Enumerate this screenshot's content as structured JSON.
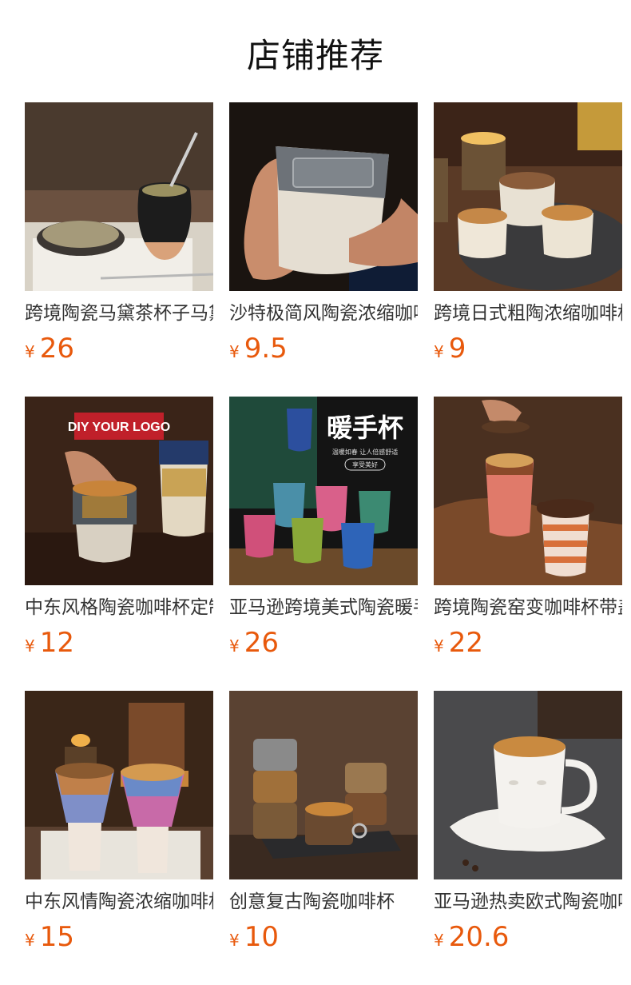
{
  "page": {
    "title": "店铺推荐"
  },
  "products": [
    {
      "name": "跨境陶瓷马黛茶杯子马黛茶壶",
      "currency": "¥",
      "price": "26",
      "image": "black-mate-cup-with-straw"
    },
    {
      "name": "沙特极简风陶瓷浓缩咖啡杯",
      "currency": "¥",
      "price": "9.5",
      "image": "hand-holding-grey-cup"
    },
    {
      "name": "跨境日式粗陶浓缩咖啡杯",
      "currency": "¥",
      "price": "9",
      "image": "three-latte-cups-on-slate"
    },
    {
      "name": "中东风格陶瓷咖啡杯定制",
      "currency": "¥",
      "price": "12",
      "image": "diy-logo-cups"
    },
    {
      "name": "亚马逊跨境美式陶瓷暖手杯",
      "currency": "¥",
      "price": "26",
      "image": "colorful-hand-warmer-cups"
    },
    {
      "name": "跨境陶瓷窑变咖啡杯带盖",
      "currency": "¥",
      "price": "22",
      "image": "striped-cups-with-lids"
    },
    {
      "name": "中东风情陶瓷浓缩咖啡杯",
      "currency": "¥",
      "price": "15",
      "image": "glazed-cone-cups"
    },
    {
      "name": "创意复古陶瓷咖啡杯",
      "currency": "¥",
      "price": "10",
      "image": "stacked-rustic-mugs"
    },
    {
      "name": "亚马逊热卖欧式陶瓷咖啡杯",
      "currency": "¥",
      "price": "20.6",
      "image": "face-cup-on-saucer"
    }
  ],
  "image_text": {
    "diy_logo": "DIY YOUR LOGO",
    "warm_cup": "暖手杯",
    "warm_sub": "温暖如春 让人倍感舒适",
    "warm_tag": "享受美好"
  },
  "colors": {
    "price": "#e8590c",
    "title": "#111111",
    "name": "#333333"
  }
}
